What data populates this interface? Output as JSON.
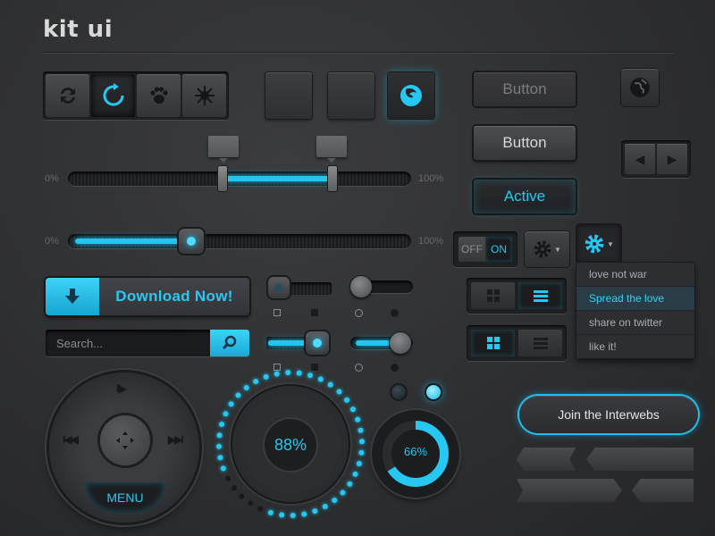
{
  "title": "kit ui",
  "buttons": {
    "disabled_label": "Button",
    "default_label": "Button",
    "active_label": "Active"
  },
  "sliders": {
    "min_label": "0%",
    "max_label": "100%",
    "range": [
      0.45,
      0.77
    ],
    "single": 0.36
  },
  "toggle": {
    "off": "OFF",
    "on": "ON"
  },
  "dropdown": {
    "items": [
      "love not war",
      "Spread the love",
      "share on twitter",
      "like it!"
    ],
    "selected_index": 1
  },
  "download": {
    "label": "Download Now!"
  },
  "search": {
    "placeholder": "Search..."
  },
  "dpad": {
    "menu_label": "MENU"
  },
  "gauges": {
    "big": {
      "label": "88%",
      "value": 0.88
    },
    "small": {
      "label": "66%",
      "value": 0.66
    }
  },
  "cta": {
    "join_label": "Join the Interwebs"
  },
  "colors": {
    "accent": "#26c8f2",
    "background": "#2e2f31"
  },
  "icons": [
    "refresh-icon",
    "reload-icon",
    "paw-icon",
    "spiral-icon",
    "firefox-icon",
    "globe-icon",
    "arrow-left-icon",
    "arrow-right-icon",
    "gear-icon",
    "grid-icon",
    "list-icon",
    "download-icon",
    "search-icon"
  ]
}
